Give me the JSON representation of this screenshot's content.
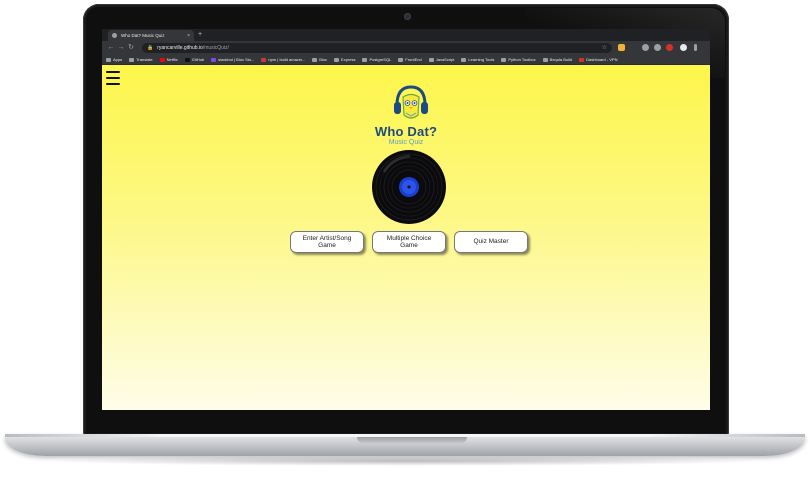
{
  "browser": {
    "tab_title": "Who Dat? Music Quiz",
    "tab_close": "×",
    "new_tab": "+",
    "url_host": "ryancarville.github.io",
    "url_path": "/musicQuiz/",
    "back": "←",
    "forward": "→",
    "reload": "↻",
    "star": "☆"
  },
  "bookmarks": [
    "Apps",
    "Translate",
    "Netflix",
    "GitHub",
    "slackbot | Bloc Stu...",
    "npm | build amazin...",
    "Bloc",
    "Express",
    "PostgreSQL",
    "FrontEnd",
    "JavaScript",
    "Learning Tools",
    "Python Toolbox",
    "Bequia Build",
    "Dashboard - VPN"
  ],
  "page": {
    "title": "Who Dat?",
    "subtitle": "Music Quiz",
    "buttons": {
      "enter_artist_song": "Enter Artist/Song Game",
      "multiple_choice": "Multiple Choice Game",
      "quiz_master": "Quiz Master"
    }
  },
  "colors": {
    "page_top": "#fdf64a",
    "page_bottom": "#fefde9",
    "title": "#1d4a80",
    "subtitle": "#5f9fbf",
    "record_label": "#1a3fcf"
  }
}
